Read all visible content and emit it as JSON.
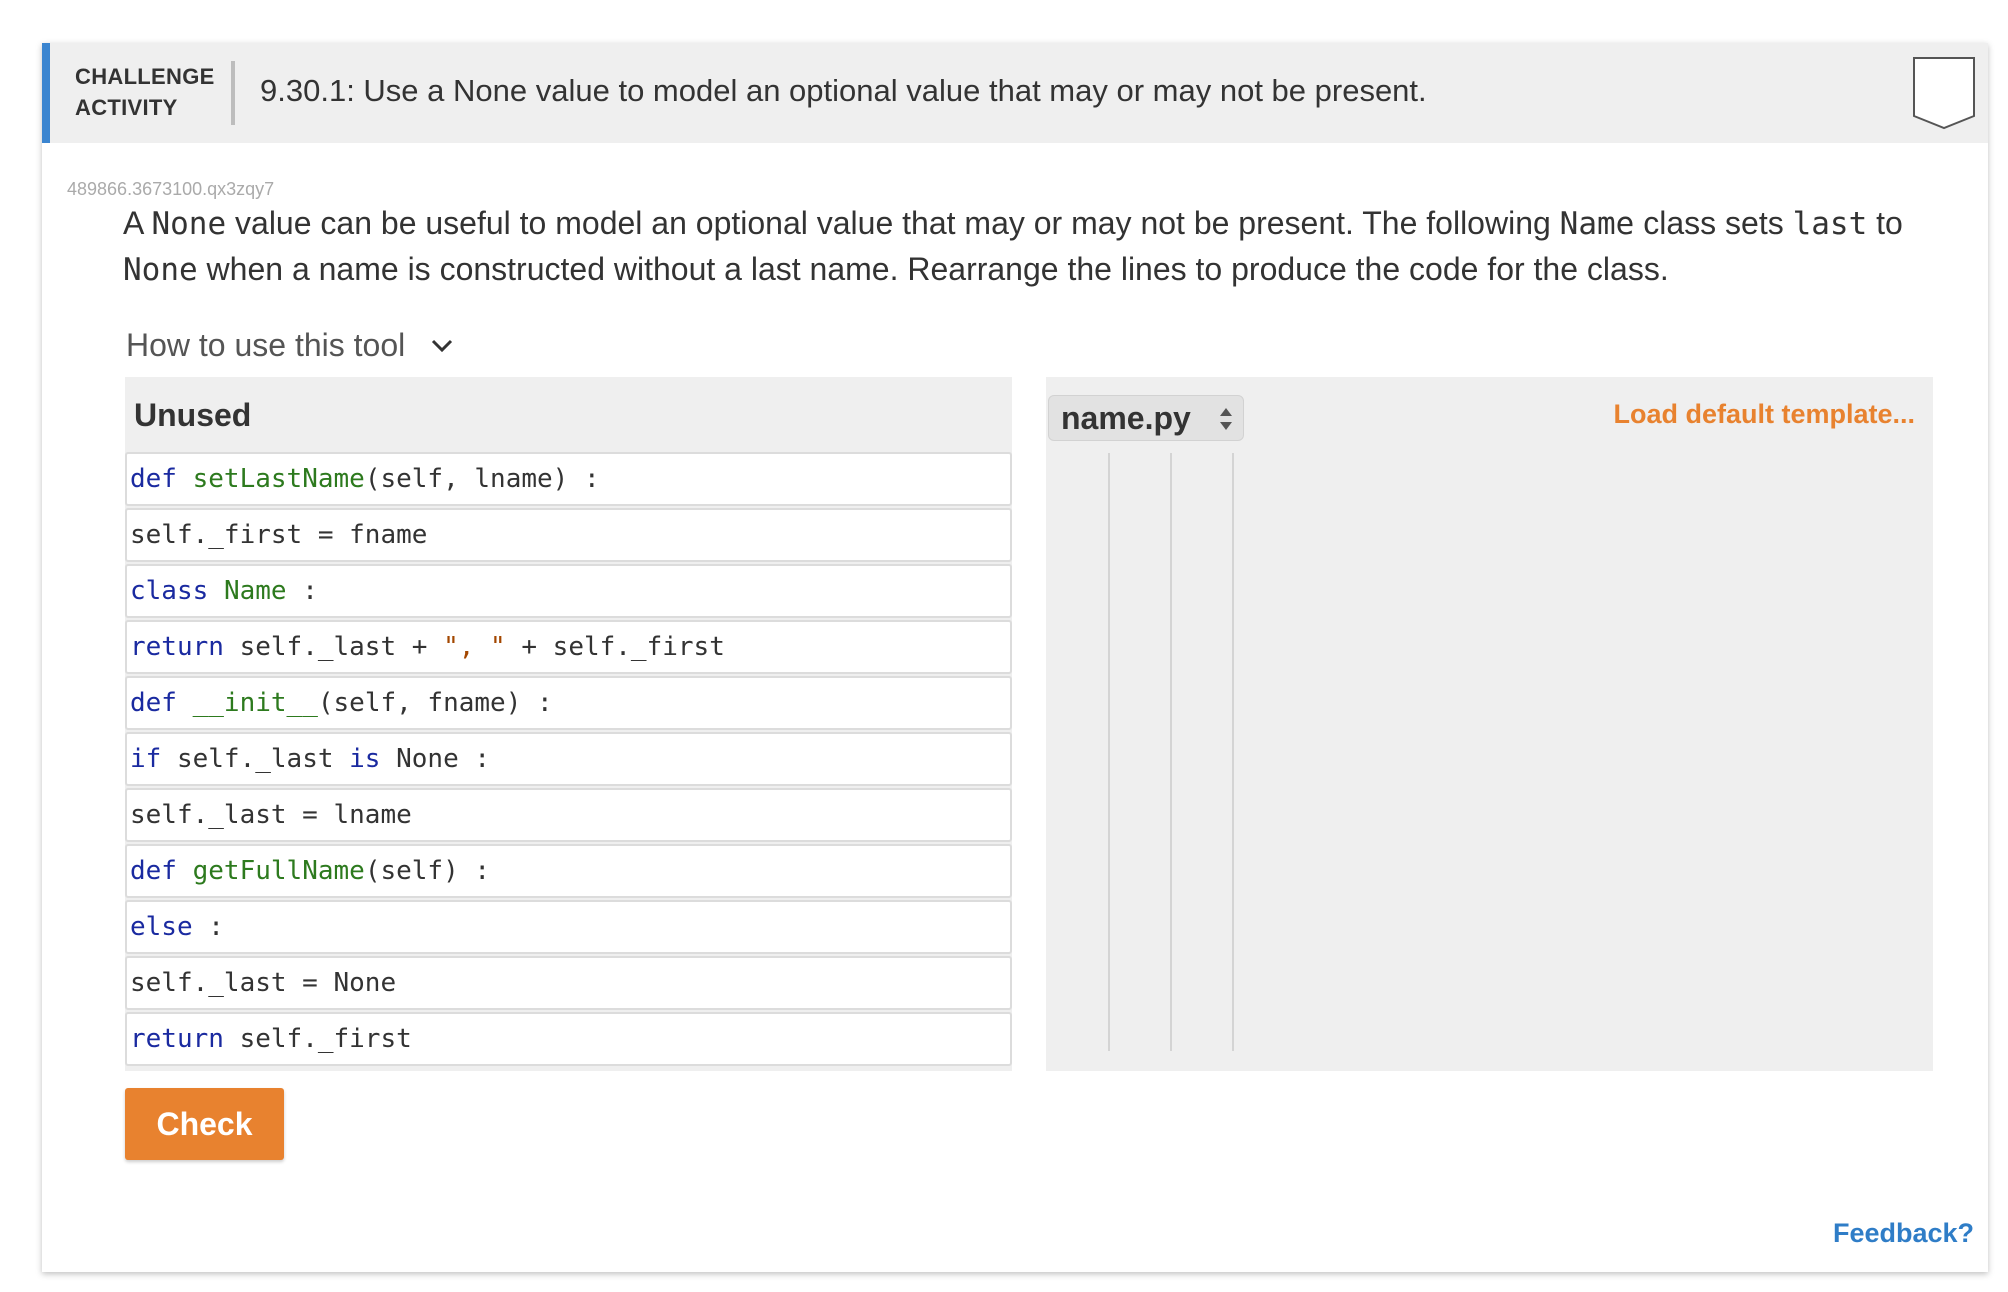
{
  "header": {
    "label_line1": "CHALLENGE",
    "label_line2": "ACTIVITY",
    "title": "9.30.1: Use a None value to model an optional value that may or may not be present."
  },
  "activity_id": "489866.3673100.qx3zqy7",
  "prompt": {
    "p1": "A ",
    "c1": "None",
    "p2": " value can be useful to model an optional value that may or may not be present. The following ",
    "c2": "Name",
    "p3": " class sets ",
    "c3": "last",
    "p4": " to ",
    "c4": "None",
    "p5": " when a name is constructed without a last name. Rearrange the lines to produce the code for the class."
  },
  "howto": {
    "label": "How to use this tool",
    "icon": "chevron-down-icon"
  },
  "unused": {
    "title": "Unused",
    "blocks": [
      {
        "t1": "def",
        "t2": " ",
        "t3": "setLastName",
        "t4": "(self, lname) :"
      },
      {
        "t1": "self._first = fname"
      },
      {
        "t1": "class",
        "t2": " ",
        "t3": "Name",
        "t4": " :"
      },
      {
        "t1": "return",
        "t2": " self._last + ",
        "t3": "\", \"",
        "t4": " + self._first"
      },
      {
        "t1": "def",
        "t2": " ",
        "t3": "__init__",
        "t4": "(self, fname) :"
      },
      {
        "t1": "if",
        "t2": " self._last ",
        "t3": "is",
        "t4": " None :"
      },
      {
        "t1": "self._last = lname"
      },
      {
        "t1": "def",
        "t2": " ",
        "t3": "getFullName",
        "t4": "(self) :"
      },
      {
        "t1": "else",
        "t2": " :"
      },
      {
        "t1": "self._last = None"
      },
      {
        "t1": "return",
        "t2": " self._first"
      }
    ]
  },
  "answer": {
    "file_name": "name.py",
    "load_default": "Load default template..."
  },
  "check_label": "Check",
  "feedback_label": "Feedback?",
  "colors": {
    "accent_blue": "#3b85d0",
    "orange": "#e8822f",
    "link_blue": "#2f7dc7",
    "keyword": "#1a2aa0",
    "identifier": "#2d7a1e",
    "string": "#a34700"
  }
}
